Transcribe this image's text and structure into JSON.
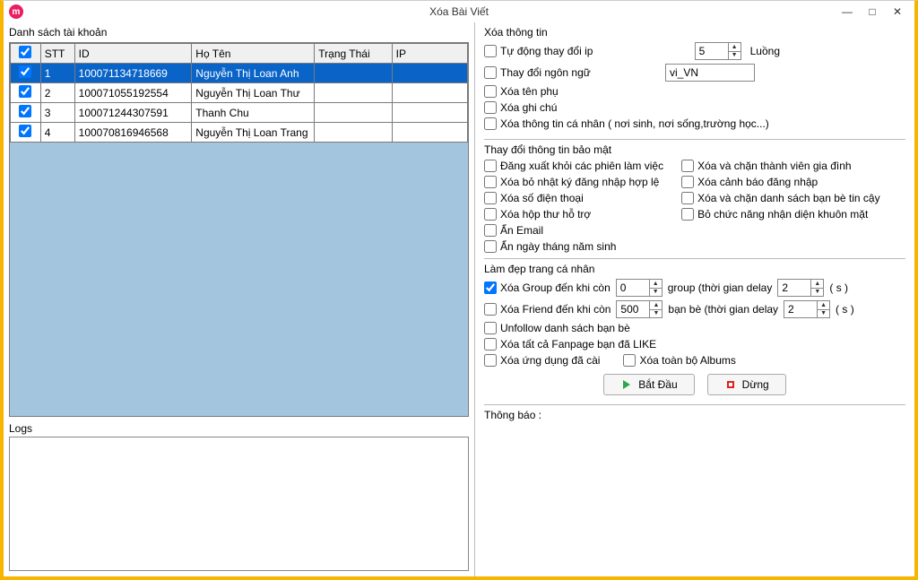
{
  "title": "Xóa Bài Viết",
  "left": {
    "list_label": "Danh sách tài khoản",
    "columns": {
      "stt": "STT",
      "id": "ID",
      "name": "Họ Tên",
      "status": "Trạng Thái",
      "ip": "IP"
    },
    "rows": [
      {
        "stt": "1",
        "id": "100071134718669",
        "name": "Nguyễn Thị Loan Anh",
        "status": "",
        "ip": "",
        "checked": true,
        "selected": true
      },
      {
        "stt": "2",
        "id": "100071055192554",
        "name": "Nguyễn Thị Loan Thư",
        "status": "",
        "ip": "",
        "checked": true,
        "selected": false
      },
      {
        "stt": "3",
        "id": "100071244307591",
        "name": "Thanh Chu",
        "status": "",
        "ip": "",
        "checked": true,
        "selected": false
      },
      {
        "stt": "4",
        "id": "100070816946568",
        "name": "Nguyễn Thị Loan Trang",
        "status": "",
        "ip": "",
        "checked": true,
        "selected": false
      }
    ],
    "logs_label": "Logs"
  },
  "info": {
    "title": "Xóa thông tin",
    "auto_ip": "Tự động thay đổi ip",
    "threads_value": "5",
    "threads_label": "Luồng",
    "change_lang": "Thay đổi ngôn ngữ",
    "lang_value": "vi_VN",
    "del_subname": "Xóa tên phụ",
    "del_note": "Xóa ghi chú",
    "del_personal": "Xóa thông tin cá nhân ( nơi sinh, nơi sống,trường học...)"
  },
  "security": {
    "title": "Thay đổi thông tin bảo mật",
    "col1": {
      "a": "Đăng xuất khỏi các phiên làm việc",
      "b": "Xóa bỏ nhật ký đăng nhập hợp lệ",
      "c": "Xóa số điện thoại",
      "d": "Xóa hộp thư hỗ trợ",
      "e": "Ẩn Email",
      "f": "Ẩn ngày tháng năm sinh"
    },
    "col2": {
      "a": "Xóa và chặn thành viên gia đình",
      "b": "Xóa cảnh báo đăng nhập",
      "c": "Xóa và chặn danh sách bạn bè tin cậy",
      "d": "Bỏ chức năng nhận diện khuôn mặt"
    }
  },
  "beautify": {
    "title": "Làm đẹp trang cá nhân",
    "del_group": "Xóa Group đến khi còn",
    "group_value": "0",
    "group_text": "group (thời gian delay",
    "group_delay": "2",
    "sec_unit_1": "( s )",
    "del_friend": "Xóa Friend đến khi còn",
    "friend_value": "500",
    "friend_text": "bạn bè (thời gian delay",
    "friend_delay": "2",
    "sec_unit_2": "( s )",
    "unfollow": "Unfollow danh sách bạn bè",
    "del_fanpage": "Xóa tất cả Fanpage bạn đã LIKE",
    "del_apps": "Xóa ứng dụng đã cài",
    "del_albums": "Xóa toàn bộ Albums"
  },
  "buttons": {
    "start": "Bắt Đầu",
    "stop": "Dừng"
  },
  "notice_label": "Thông báo :"
}
